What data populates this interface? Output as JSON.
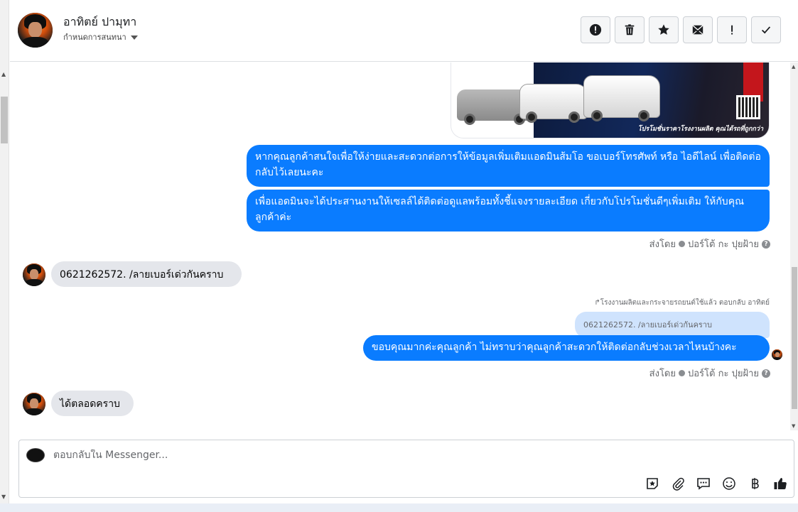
{
  "header": {
    "name": "อาทิตย์ ปามุทา",
    "subtitle": "กำหนดการสนทนา",
    "toolbar": [
      "report-icon",
      "trash-icon",
      "star-icon",
      "mail-icon",
      "important-icon",
      "check-icon"
    ]
  },
  "messages": {
    "image_caption": "โปรโมชั่นราคาโรงงานผลิต คุณได้รถที่ถูกกว่า",
    "out_1": "หากคุณลูกค้าสนใจเพื่อให้ง่ายและสะดวกต่อการให้ข้อมูลเพิ่มเติมแอดมินส้มโอ ขอเบอร์โทรศัพท์ หรือ ไอดีไลน์ เพื่อติดต่อกลับไว้เลยนะคะ",
    "out_2": "เพื่อแอดมินจะได้ประสานงานให้เซลล์ได้ติดต่อดูแลพร้อมทั้งชี้แจงรายละเอียด เกี่ยวกับโปรโมชั่นดีๆเพิ่มเติม ให้กับคุณลูกค้าค่ะ",
    "sent_by_label": "ส่งโดย",
    "sent_by_name": "ปอร์โต้ กะ ปุยฝ้าย",
    "in_1": "0621262572.  /ลายเบอร์เด่วกันคราบ",
    "reply_note": "โรงงานผลิตและกระจายรถยนต์ใช้แล้ว ตอบกลับ อาทิตย์",
    "quoted": "0621262572.  /ลายเบอร์เด่วกันคราบ",
    "out_3": "ขอบคุณมากค่ะคุณลูกค้า ไม่ทราบว่าคุณลูกค้าสะดวกให้ติดต่อกลับช่วงเวลาไหนบ้างคะ",
    "in_2": "ได้ตลอดคราบ"
  },
  "composer": {
    "placeholder": "ตอบกลับใน Messenger...",
    "icons": [
      "sticker-icon",
      "attachment-icon",
      "saved-reply-icon",
      "emoji-icon",
      "baht-icon",
      "like-icon"
    ]
  },
  "colors": {
    "accent": "#0a7cff",
    "incoming_bubble": "#e4e6eb",
    "quoted_bubble": "#cfe3fd"
  }
}
